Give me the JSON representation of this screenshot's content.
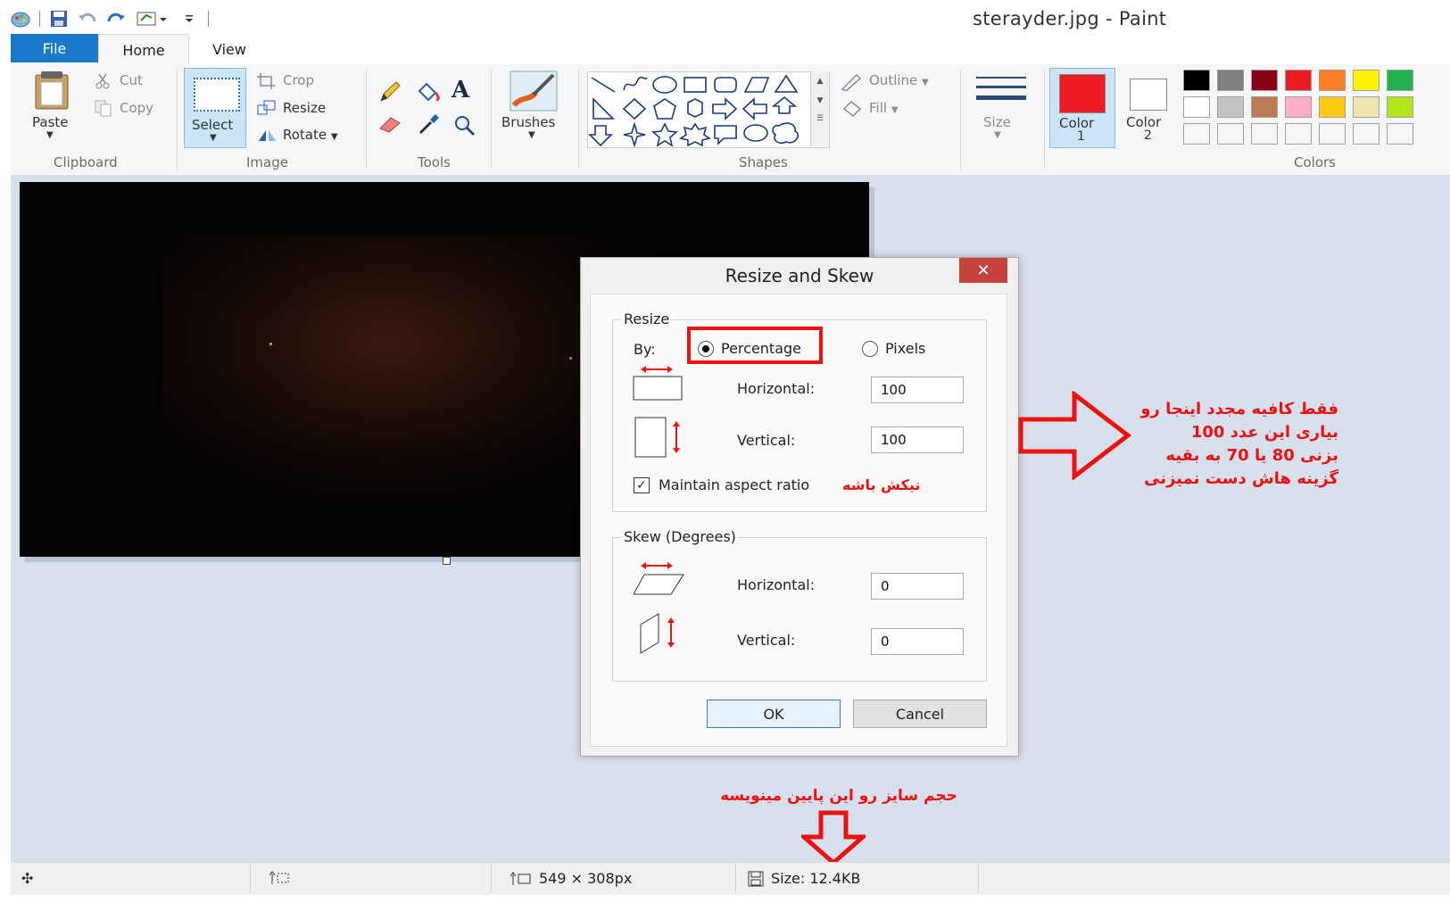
{
  "window": {
    "title": "sterayder.jpg - Paint"
  },
  "tabs": {
    "file": "File",
    "home": "Home",
    "view": "View"
  },
  "ribbon": {
    "clipboard": {
      "label": "Clipboard",
      "paste": "Paste",
      "cut": "Cut",
      "copy": "Copy"
    },
    "image": {
      "label": "Image",
      "select": "Select",
      "crop": "Crop",
      "resize": "Resize",
      "rotate": "Rotate"
    },
    "tools": {
      "label": "Tools"
    },
    "brushes": {
      "label": "Brushes"
    },
    "shapes": {
      "label": "Shapes",
      "outline": "Outline",
      "fill": "Fill"
    },
    "size": {
      "label": "Size"
    },
    "color1": {
      "label": "Color",
      "num": "1",
      "value": "#ed1c24"
    },
    "color2": {
      "label": "Color",
      "num": "2",
      "value": "#ffffff"
    },
    "colors": {
      "label": "Colors",
      "row1": [
        "#000000",
        "#7f7f7f",
        "#880015",
        "#ed1c24",
        "#ff7f27",
        "#fff200",
        "#22b14c"
      ],
      "row2": [
        "#ffffff",
        "#c3c3c3",
        "#b97a57",
        "#ffaec9",
        "#ffc90e",
        "#efe4b0",
        "#b5e61d"
      ]
    }
  },
  "dialog": {
    "title": "Resize and Skew",
    "close": "✕",
    "resize": {
      "legend": "Resize",
      "by": "By:",
      "percentage": "Percentage",
      "pixels": "Pixels",
      "horizontal_label": "Horizontal:",
      "horizontal_value": "100",
      "vertical_label": "Vertical:",
      "vertical_value": "100",
      "maintain": "Maintain aspect ratio"
    },
    "skew": {
      "legend": "Skew (Degrees)",
      "horizontal_label": "Horizontal:",
      "horizontal_value": "0",
      "vertical_label": "Vertical:",
      "vertical_value": "0"
    },
    "ok": "OK",
    "cancel": "Cancel"
  },
  "status": {
    "dimensions": "549 × 308px",
    "size": "Size: 12.4KB"
  },
  "annotations": {
    "right_note": [
      "فقط کافیه مجدد اینجا رو",
      "بیاری این عدد 100",
      "بزنی 80 یا 70 به بقیه",
      "گزینه هاش دست نمیزنی"
    ],
    "checked_note": "تیکش باشه",
    "bottom_note": "حجم سایز رو این پایین مینویسه",
    "accent_color": "#e11111"
  }
}
